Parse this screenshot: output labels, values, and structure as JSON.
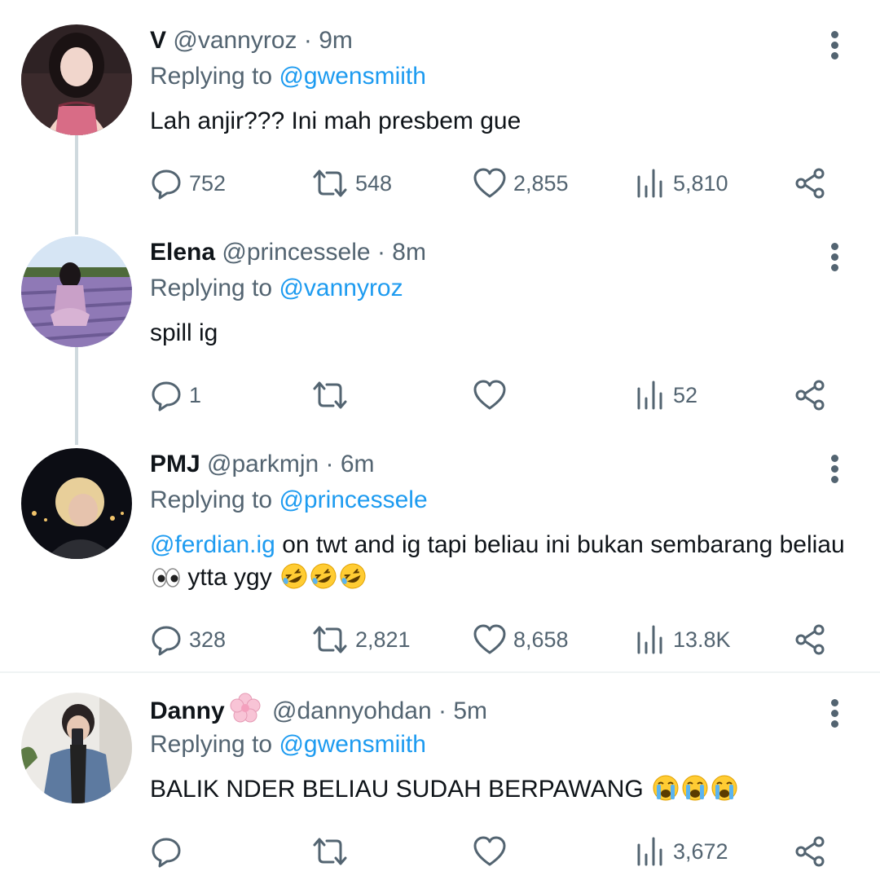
{
  "colors": {
    "accent": "#1d9bf0",
    "secondary_text": "#536471",
    "primary_text": "#0f1419",
    "thread_line": "#cfd9de"
  },
  "tweets": [
    {
      "name": "V",
      "handle": "@vannyroz",
      "separator": "·",
      "time": "9m",
      "replying_prefix": "Replying to",
      "replying_to": "@gwensmiith",
      "text_parts": [
        "Lah anjir??? Ini mah presbem gue"
      ],
      "replies": "752",
      "retweets": "548",
      "likes": "2,855",
      "views": "5,810"
    },
    {
      "name": "Elena",
      "handle": "@princessele",
      "separator": "·",
      "time": "8m",
      "replying_prefix": "Replying to",
      "replying_to": "@vannyroz",
      "text_parts": [
        "spill ig"
      ],
      "replies": "1",
      "retweets": "",
      "likes": "",
      "views": "52"
    },
    {
      "name": "PMJ",
      "handle": "@parkmjn",
      "separator": "·",
      "time": "6m",
      "replying_prefix": "Replying to",
      "replying_to": "@princessele",
      "text_mention": "@ferdian.ig",
      "text_parts": [
        " on twt and ig tapi beliau ini bukan sembarang beliau ",
        " ytta ygy "
      ],
      "emojis": [
        "eyes-emoji",
        "rolling-laughing-emoji",
        "rolling-laughing-emoji",
        "rolling-laughing-emoji"
      ],
      "replies": "328",
      "retweets": "2,821",
      "likes": "8,658",
      "views": "13.8K"
    },
    {
      "name": "Danny",
      "name_emoji": "cherry-blossom-emoji",
      "handle": "@dannyohdan",
      "separator": "·",
      "time": "5m",
      "replying_prefix": "Replying to",
      "replying_to": "@gwensmiith",
      "text_parts": [
        "BALIK NDER BELIAU SUDAH BERPAWANG "
      ],
      "emojis": [
        "crying-emoji",
        "crying-emoji",
        "crying-emoji"
      ],
      "replies": "",
      "retweets": "",
      "likes": "",
      "views": "3,672"
    }
  ]
}
